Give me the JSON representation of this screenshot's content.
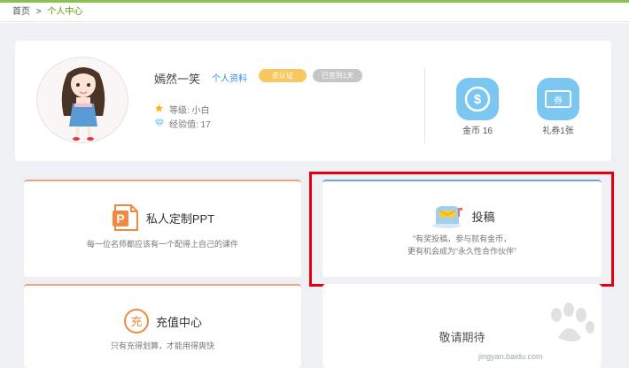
{
  "breadcrumb": {
    "home": "首页",
    "separator": ">",
    "current": "个人中心"
  },
  "profile": {
    "username": "嫣然一笑",
    "profile_link": "个人资料",
    "verify_badge": "去认证",
    "signed_badge": "已签到1天",
    "level_label": "等级: 小白",
    "exp_label": "经验值: 17",
    "level_icon": "star-icon",
    "exp_icon": "diamond-icon"
  },
  "stats": {
    "coins_label": "金币 16",
    "coins_icon": "dollar-coin-icon",
    "coupons_label": "礼券1张",
    "coupons_icon": "coupon-icon",
    "coupon_icon_text": "券"
  },
  "tiles": {
    "ppt": {
      "title": "私人定制PPT",
      "desc": "每一位名师都应该有一个配得上自己的课件",
      "icon": "ppt-file-icon",
      "icon_text": "P"
    },
    "submit": {
      "title": "投稿",
      "desc_line1": "\"有奖投稿，参与就有金币，",
      "desc_line2": "更有机会成为“永久性合作伙伴”",
      "icon": "mailbox-icon"
    },
    "recharge": {
      "title": "充值中心",
      "desc": "只有充得划算，才能用得爽快",
      "icon": "recharge-icon",
      "icon_text": "充"
    },
    "soon": {
      "title": "敬请期待"
    }
  },
  "watermark": {
    "url": "jingyan.baidu.com"
  },
  "colors": {
    "accent_green": "#8cc152",
    "link_blue": "#3a8ee6",
    "badge_yellow": "#f6c85f",
    "stat_blue": "#7cc6f2",
    "tile_orange": "#f1a27a",
    "tile_blue": "#6fa8dc",
    "highlight_red": "#e60012"
  }
}
